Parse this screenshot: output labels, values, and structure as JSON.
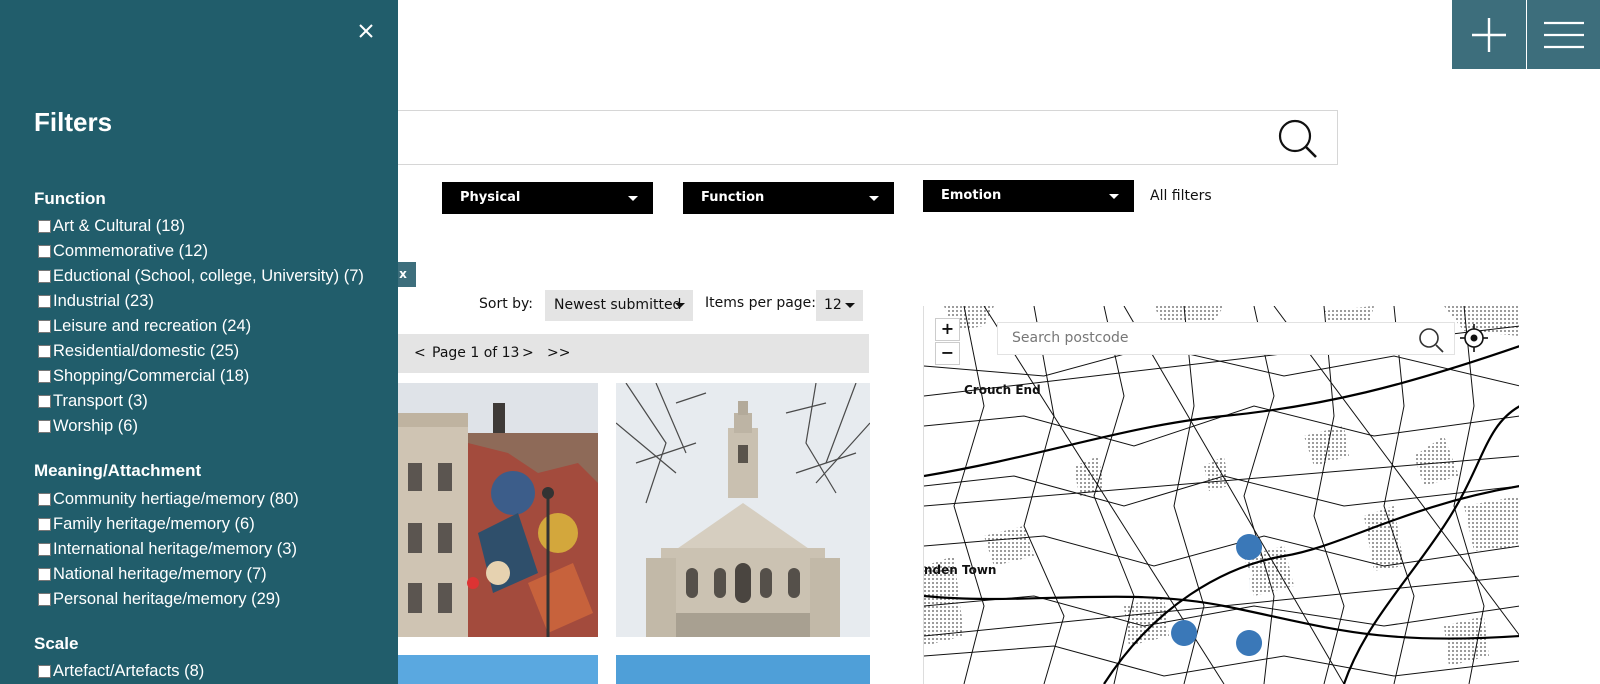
{
  "header": {
    "add_icon": "plus-icon",
    "menu_icon": "hamburger-menu-icon"
  },
  "search": {
    "icon": "search-icon"
  },
  "filter_dropdowns": [
    {
      "label": "Physical"
    },
    {
      "label": "Function"
    },
    {
      "label": "Emotion"
    }
  ],
  "all_filters_label": "All filters",
  "clear_tag_label": "x",
  "sort": {
    "label": "Sort by:",
    "value": "Newest submitted"
  },
  "items_per_page": {
    "label": "Items per page:",
    "value": "12"
  },
  "pagination": {
    "prev": "<",
    "page_text": "Page 1 of 13",
    "next": ">",
    "last": ">>"
  },
  "map": {
    "search_placeholder": "Search postcode",
    "zoom_in": "+",
    "zoom_out": "−",
    "labels": [
      "Crouch End",
      "nden Town"
    ]
  },
  "filters_panel": {
    "title": "Filters",
    "close_icon": "close-icon",
    "sections": [
      {
        "title": "Function",
        "options": [
          "Art & Cultural (18)",
          "Commemorative (12)",
          "Eductional (School, college, University) (7)",
          "Industrial (23)",
          "Leisure and recreation (24)",
          "Residential/domestic (25)",
          "Shopping/Commercial (18)",
          "Transport (3)",
          "Worship (6)"
        ]
      },
      {
        "title": "Meaning/Attachment",
        "options": [
          "Community hertiage/memory (80)",
          "Family heritage/memory (6)",
          "International heritage/memory (3)",
          "National heritage/memory (7)",
          "Personal heritage/memory (29)"
        ]
      },
      {
        "title": "Scale",
        "options": [
          "Artefact/Artefacts (8)"
        ]
      }
    ]
  },
  "colors": {
    "panel": "#215d6b",
    "accent": "#3d6e7c",
    "dropdown": "#000000",
    "marker": "#3a78b8"
  }
}
